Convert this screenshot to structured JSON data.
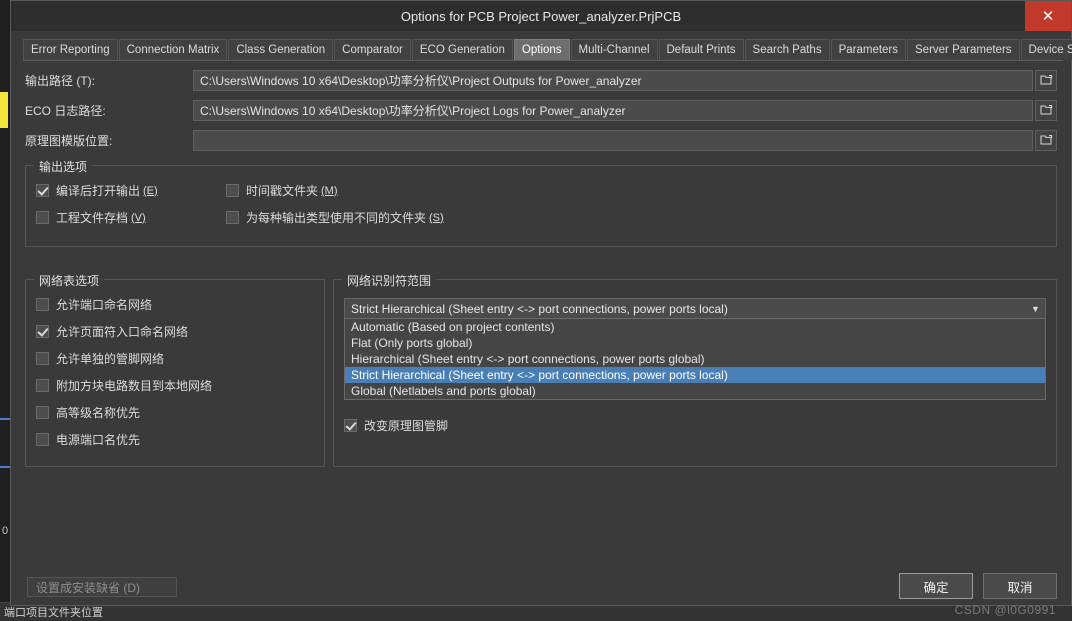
{
  "window": {
    "title": "Options for PCB Project Power_analyzer.PrjPCB",
    "close_icon": "close-icon"
  },
  "tabs": [
    {
      "label": "Error Reporting",
      "active": false
    },
    {
      "label": "Connection Matrix",
      "active": false
    },
    {
      "label": "Class Generation",
      "active": false
    },
    {
      "label": "Comparator",
      "active": false
    },
    {
      "label": "ECO Generation",
      "active": false
    },
    {
      "label": "Options",
      "active": true
    },
    {
      "label": "Multi-Channel",
      "active": false
    },
    {
      "label": "Default Prints",
      "active": false
    },
    {
      "label": "Search Paths",
      "active": false
    },
    {
      "label": "Parameters",
      "active": false
    },
    {
      "label": "Server Parameters",
      "active": false
    },
    {
      "label": "Device Sheet",
      "active": false
    }
  ],
  "tab_scroll": {
    "left": "◄",
    "right": "►"
  },
  "paths": [
    {
      "label": "输出路径 (T):",
      "value": "C:\\Users\\Windows 10 x64\\Desktop\\功率分析仪\\Project Outputs for Power_analyzer",
      "browse_icon": "folder-browse-icon"
    },
    {
      "label": "ECO 日志路径:",
      "value": "C:\\Users\\Windows 10 x64\\Desktop\\功率分析仪\\Project Logs for Power_analyzer",
      "browse_icon": "folder-browse-icon"
    },
    {
      "label": "原理图模版位置:",
      "value": "",
      "browse_icon": "folder-browse-icon"
    }
  ],
  "output_options": {
    "title": "输出选项",
    "items": [
      {
        "label": "编译后打开输出",
        "mnemonic": "(E)",
        "checked": true
      },
      {
        "label": "时间戳文件夹",
        "mnemonic": "(M)",
        "checked": false
      },
      {
        "label": "工程文件存档",
        "mnemonic": "(V)",
        "checked": false
      },
      {
        "label": "为每种输出类型使用不同的文件夹",
        "mnemonic": "(S)",
        "checked": false
      }
    ]
  },
  "netlist_options": {
    "title": "网络表选项",
    "items": [
      {
        "label": "允许端口命名网络",
        "checked": false
      },
      {
        "label": "允许页面符入口命名网络",
        "checked": true
      },
      {
        "label": "允许单独的管脚网络",
        "checked": false
      },
      {
        "label": "附加方块电路数目到本地网络",
        "checked": false
      },
      {
        "label": "高等级名称优先",
        "checked": false
      },
      {
        "label": "电源端口名优先",
        "checked": false
      }
    ]
  },
  "net_identifier": {
    "title": "网络识别符范围",
    "selected": "Strict Hierarchical (Sheet entry <-> port connections, power ports local)",
    "dropdown_open": true,
    "options": [
      "Automatic (Based on project contents)",
      "Flat (Only ports global)",
      "Hierarchical (Sheet entry <-> port connections, power ports global)",
      "Strict Hierarchical (Sheet entry <-> port connections, power ports local)",
      "Global (Netlabels and ports global)"
    ],
    "selected_index": 3,
    "checkbox": {
      "label": "改变原理图管脚",
      "checked": true
    }
  },
  "footer": {
    "set_default": "设置成安装缺省 (D)",
    "ok": "确定",
    "cancel": "取消"
  },
  "watermark": "CSDN @l0G0991",
  "background": {
    "status_text": "端口项目文件夹位置"
  }
}
